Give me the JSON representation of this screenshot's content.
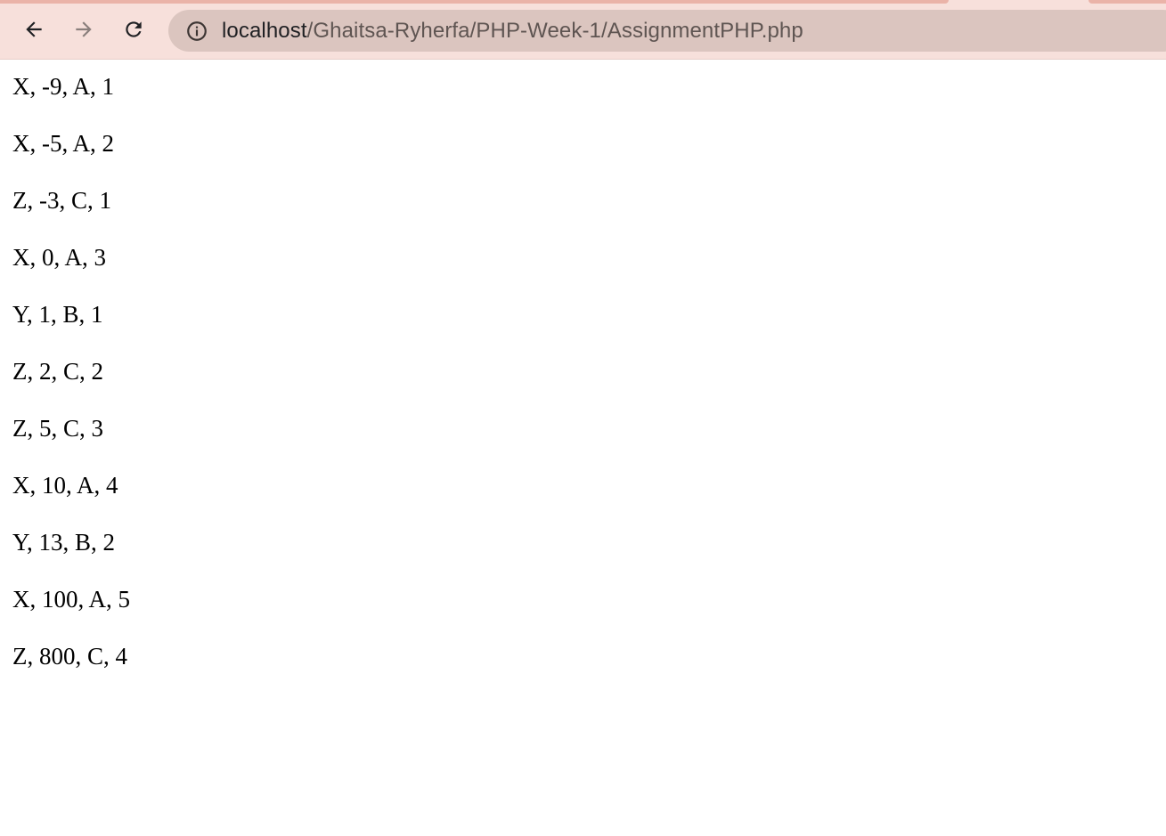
{
  "browser": {
    "url_host": "localhost",
    "url_path": "/Ghaitsa-Ryherfa/PHP-Week-1/AssignmentPHP.php",
    "icons": {
      "back": "arrow-left-icon",
      "forward": "arrow-right-icon",
      "reload": "reload-icon",
      "site_info": "info-icon"
    }
  },
  "page": {
    "lines": [
      "X, -9, A, 1",
      "X, -5, A, 2",
      "Z, -3, C, 1",
      "X, 0, A, 3",
      "Y, 1, B, 1",
      "Z, 2, C, 2",
      "Z, 5, C, 3",
      "X, 10, A, 4",
      "Y, 13, B, 2",
      "X, 100, A, 5",
      "Z, 800, C, 4"
    ]
  }
}
